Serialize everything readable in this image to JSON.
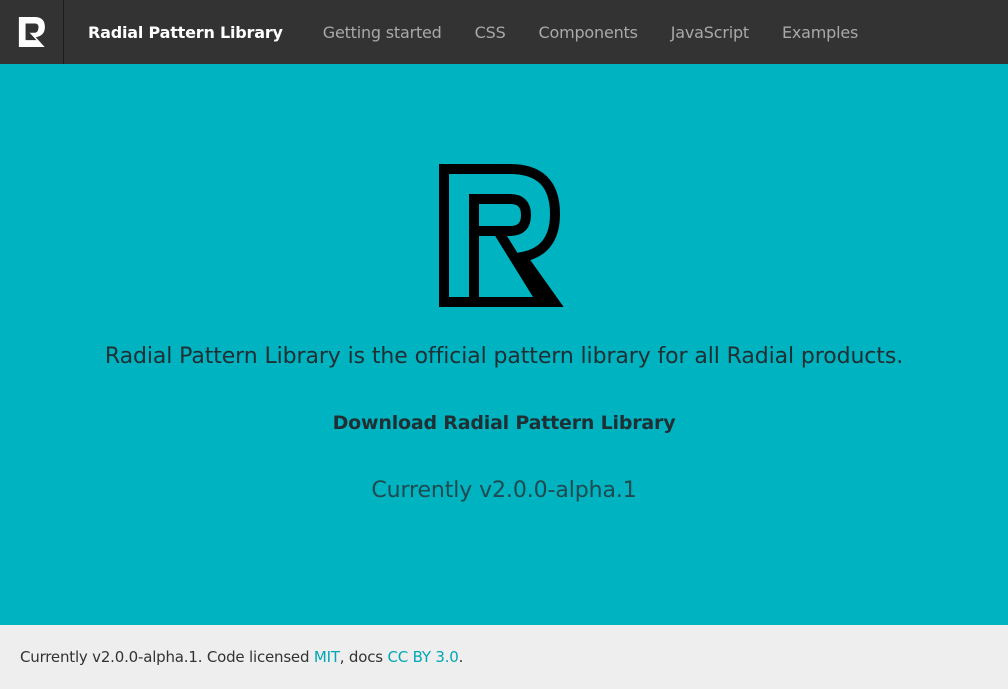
{
  "navbar": {
    "brand": "Radial Pattern Library",
    "logo_icon": "radial-r-logo-icon",
    "links": [
      "Getting started",
      "CSS",
      "Components",
      "JavaScript",
      "Examples"
    ]
  },
  "hero": {
    "logo_icon": "radial-r-logo-icon",
    "tagline": "Radial Pattern Library is the official pattern library for all Radial products.",
    "download_label": "Download Radial Pattern Library",
    "version_text": "Currently v2.0.0-alpha.1"
  },
  "footer": {
    "prefix": "Currently v2.0.0-alpha.1. Code licensed ",
    "license_link": "MIT",
    "middle": ", docs ",
    "docs_link": "CC BY 3.0",
    "suffix": "."
  },
  "colors": {
    "navbar_bg": "#333333",
    "hero_bg": "#00b3c0",
    "footer_bg": "#eeeeee",
    "link_accent": "#00a7b4"
  }
}
